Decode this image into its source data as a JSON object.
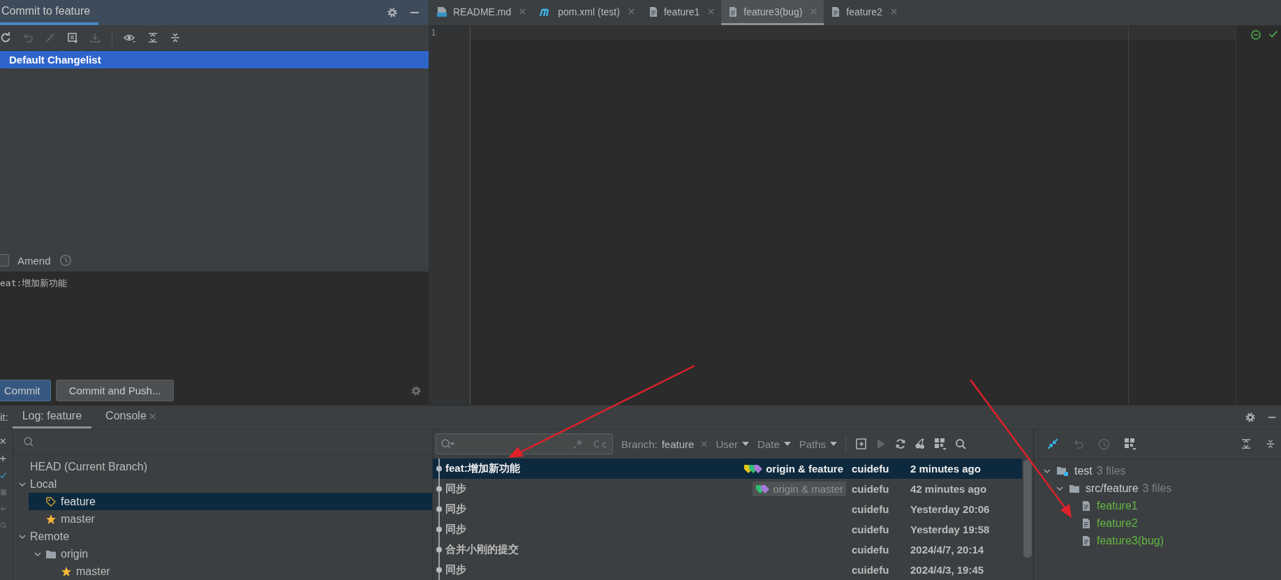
{
  "commit_panel": {
    "title": "Commit to feature",
    "changelist": {
      "label": "Default Changelist",
      "selected": true
    },
    "amend": {
      "label": "Amend",
      "checked": false
    },
    "message": "eat:增加新功能",
    "buttons": [
      {
        "label": "Commit",
        "kind": "primary"
      },
      {
        "label": "Commit and Push...",
        "kind": "secondary"
      }
    ]
  },
  "editor": {
    "tabs": [
      {
        "label": "README.md",
        "kind": "markdown",
        "selected": false
      },
      {
        "label": "pom.xml (test)",
        "kind": "maven",
        "selected": false
      },
      {
        "label": "feature1",
        "kind": "text",
        "selected": false
      },
      {
        "label": "feature3(bug)",
        "kind": "text",
        "selected": true
      },
      {
        "label": "feature2",
        "kind": "text",
        "selected": false
      }
    ],
    "line_numbers": [
      "1"
    ]
  },
  "git_panel": {
    "title_prefix": "it:",
    "tabs": [
      {
        "label": "Log: feature",
        "selected": true,
        "closable": false
      },
      {
        "label": "Console",
        "selected": false,
        "closable": true
      }
    ],
    "branches": [
      {
        "label": "HEAD (Current Branch)",
        "selected": false
      },
      {
        "label": "Local",
        "selected": false,
        "expanded": true,
        "children": [
          {
            "label": "feature",
            "kind": "tag",
            "selected": true
          },
          {
            "label": "master",
            "kind": "star",
            "selected": false
          }
        ]
      },
      {
        "label": "Remote",
        "selected": false,
        "expanded": true,
        "children": [
          {
            "label": "origin",
            "kind": "folder",
            "selected": false,
            "expanded": true,
            "children": [
              {
                "label": "master",
                "kind": "star",
                "selected": false
              }
            ]
          }
        ]
      }
    ],
    "log_filters": {
      "branch_label": "Branch:",
      "branch_value": "feature",
      "menus": [
        "User",
        "Date",
        "Paths"
      ]
    },
    "commits": [
      {
        "message": "feat:增加新功能",
        "ref": {
          "label": "origin & feature",
          "tags": [
            {
              "color": "#e6c619"
            },
            {
              "color": "#2fbf71"
            },
            {
              "color": "#a77bd9"
            }
          ]
        },
        "author": "cuidefu",
        "date": "2 minutes ago",
        "selected": true
      },
      {
        "message": "同步",
        "ref": {
          "label": "origin & master",
          "tags": [
            {
              "color": "#2fbf71"
            },
            {
              "color": "#a77bd9"
            }
          ]
        },
        "author": "cuidefu",
        "date": "42 minutes ago",
        "selected": false
      },
      {
        "message": "同步",
        "author": "cuidefu",
        "date": "Yesterday 20:06",
        "selected": false
      },
      {
        "message": "同步",
        "author": "cuidefu",
        "date": "Yesterday 19:58",
        "selected": false
      },
      {
        "message": "合并小刚的提交",
        "author": "cuidefu",
        "date": "2024/4/7, 20:14",
        "selected": false
      },
      {
        "message": "同步",
        "author": "cuidefu",
        "date": "2024/4/3, 19:45",
        "selected": false
      }
    ],
    "changes": [
      {
        "label": "test",
        "count": "3 files",
        "kind": "module",
        "expanded": true,
        "children": [
          {
            "label": "src/feature",
            "count": "3 files",
            "kind": "folder",
            "expanded": true,
            "children": [
              {
                "label": "feature1",
                "kind": "file"
              },
              {
                "label": "feature2",
                "kind": "file"
              },
              {
                "label": "feature3(bug)",
                "kind": "file"
              }
            ]
          }
        ]
      }
    ]
  }
}
